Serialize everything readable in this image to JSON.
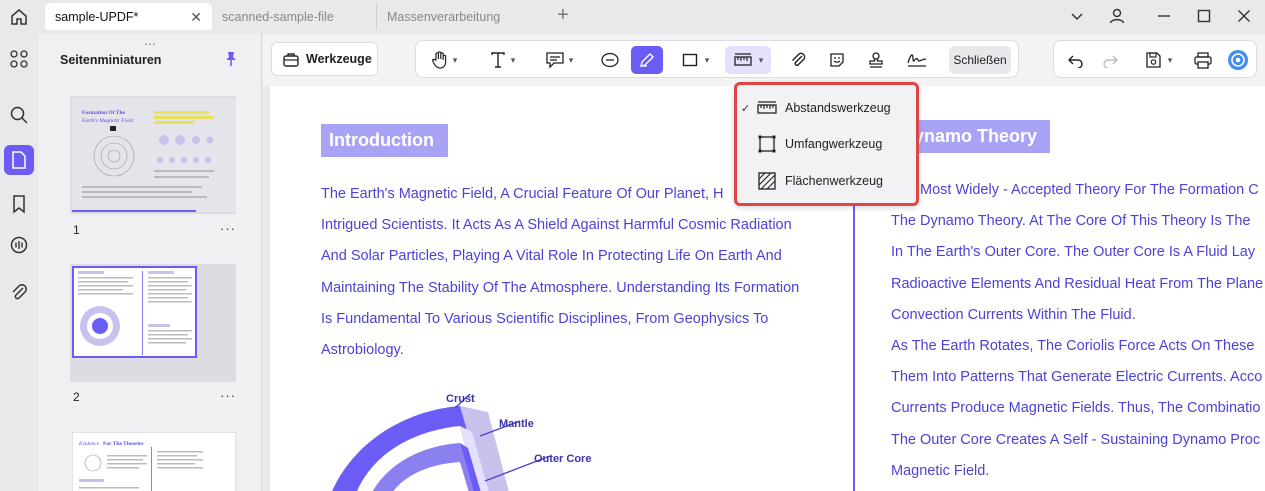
{
  "tabs": [
    {
      "label": "sample-UPDF*",
      "active": true
    },
    {
      "label": "scanned-sample-file",
      "active": false
    },
    {
      "label": "Massenverarbeitung",
      "active": false
    }
  ],
  "sidebar": {
    "title": "Seitenminiaturen",
    "pages": [
      {
        "number": "1"
      },
      {
        "number": "2"
      },
      {
        "number": ""
      }
    ],
    "more_label": "···"
  },
  "toolbar": {
    "werkzeuge_label": "Werkzeuge",
    "close_label": "Schließen"
  },
  "measure_menu": {
    "items": [
      {
        "label": "Abstandswerkzeug",
        "checked": true,
        "icon": "ruler-icon"
      },
      {
        "label": "Umfangwerkzeug",
        "checked": false,
        "icon": "perimeter-icon"
      },
      {
        "label": "Flächenwerkzeug",
        "checked": false,
        "icon": "area-icon"
      }
    ]
  },
  "document": {
    "left_heading": "Introduction",
    "left_lines": [
      "The Earth's Magnetic Field, A Crucial Feature Of Our Planet, H",
      "Intrigued Scientists. It Acts As A Shield Against Harmful Cosmic Radiation",
      "And Solar Particles, Playing A Vital Role In Protecting Life On Earth And",
      "Maintaining The Stability Of The Atmosphere. Understanding Its Formation",
      "Is Fundamental To Various Scientific Disciplines, From Geophysics To",
      "Astrobiology."
    ],
    "right_heading": "ynamo Theory",
    "right_lines": [
      "Most Widely - Accepted Theory For The Formation C",
      "The Dynamo Theory. At The Core Of This Theory Is The",
      "In The Earth's Outer Core. The Outer Core Is A Fluid Lay",
      "Radioactive Elements And Residual Heat From The Plane",
      "Convection Currents Within The Fluid.",
      "As The Earth Rotates, The Coriolis Force Acts On These",
      "Them Into Patterns That Generate Electric Currents. Acco",
      "Currents Produce Magnetic Fields. Thus, The Combinatio",
      "The Outer Core Creates A Self - Sustaining Dynamo Proc",
      "Magnetic Field."
    ],
    "diagram_labels": {
      "crust": "Crust",
      "mantle": "Mantle",
      "outer_core": "Outer Core"
    }
  },
  "colors": {
    "accent": "#6b5cf6",
    "text_blue": "#4c43d4",
    "heading_bg": "#a9a3f5",
    "highlight_border": "#e04545"
  }
}
